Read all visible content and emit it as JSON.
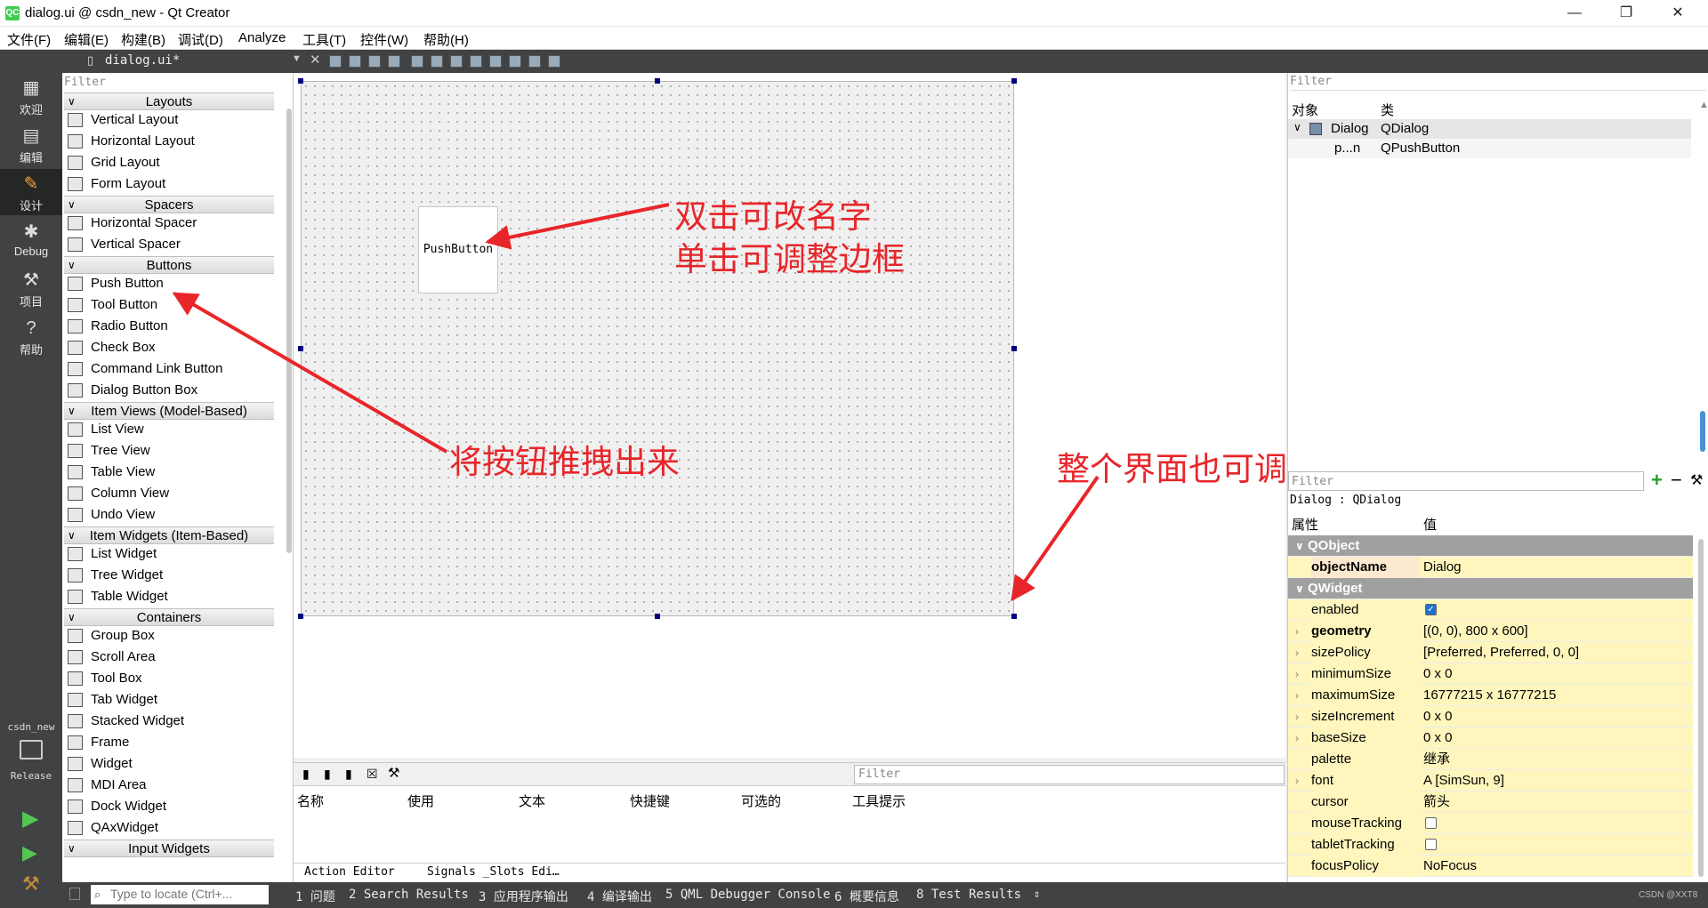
{
  "window": {
    "title": "dialog.ui @ csdn_new - Qt Creator",
    "logo": "QC",
    "minimize": "—",
    "maximize": "❐",
    "close": "✕"
  },
  "menu": [
    "文件(F)",
    "编辑(E)",
    "构建(B)",
    "调试(D)",
    "Analyze",
    "工具(T)",
    "控件(W)",
    "帮助(H)"
  ],
  "modes": [
    {
      "label": "欢迎",
      "icon": "grid-icon"
    },
    {
      "label": "编辑",
      "icon": "edit-icon"
    },
    {
      "label": "设计",
      "icon": "design-icon"
    },
    {
      "label": "Debug",
      "icon": "bug-icon"
    },
    {
      "label": "项目",
      "icon": "wrench-icon"
    },
    {
      "label": "帮助",
      "icon": "help-icon"
    }
  ],
  "kit": {
    "project": "csdn_new",
    "config": "Release"
  },
  "file_tab": {
    "name": "dialog.ui*"
  },
  "widget_box": {
    "filter_placeholder": "Filter",
    "categories": [
      {
        "name": "Layouts",
        "items": [
          "Vertical Layout",
          "Horizontal Layout",
          "Grid Layout",
          "Form Layout"
        ]
      },
      {
        "name": "Spacers",
        "items": [
          "Horizontal Spacer",
          "Vertical Spacer"
        ]
      },
      {
        "name": "Buttons",
        "items": [
          "Push Button",
          "Tool Button",
          "Radio Button",
          "Check Box",
          "Command Link Button",
          "Dialog Button Box"
        ]
      },
      {
        "name": "Item Views (Model-Based)",
        "items": [
          "List View",
          "Tree View",
          "Table View",
          "Column View",
          "Undo View"
        ]
      },
      {
        "name": "Item Widgets (Item-Based)",
        "items": [
          "List Widget",
          "Tree Widget",
          "Table Widget"
        ]
      },
      {
        "name": "Containers",
        "items": [
          "Group Box",
          "Scroll Area",
          "Tool Box",
          "Tab Widget",
          "Stacked Widget",
          "Frame",
          "Widget",
          "MDI Area",
          "Dock Widget",
          "QAxWidget"
        ]
      },
      {
        "name": "Input Widgets",
        "items": []
      }
    ]
  },
  "form": {
    "push_button_text": "PushButton"
  },
  "annotations": {
    "rename": "双击可改名字",
    "border": "单击可调整边框",
    "drag": "将按钮推拽出来",
    "resize": "整个界面也可调整大小"
  },
  "action_editor": {
    "filter_placeholder": "Filter",
    "columns": [
      "名称",
      "使用",
      "文本",
      "快捷键",
      "可选的",
      "工具提示"
    ],
    "tabs": [
      "Action Editor",
      "Signals _Slots Edi…"
    ]
  },
  "object_inspector": {
    "filter_placeholder": "Filter",
    "columns": [
      "对象",
      "类"
    ],
    "rows": [
      {
        "object": "Dialog",
        "class": "QDialog"
      },
      {
        "object": "p...n",
        "class": "QPushButton"
      }
    ]
  },
  "property_editor": {
    "filter_placeholder": "Filter",
    "context": "Dialog : QDialog",
    "columns": [
      "属性",
      "值"
    ],
    "rows": [
      {
        "type": "group",
        "name": "QObject"
      },
      {
        "type": "prop",
        "name": "objectName",
        "value": "Dialog",
        "bold": true,
        "expand": false
      },
      {
        "type": "group",
        "name": "QWidget"
      },
      {
        "type": "prop",
        "name": "enabled",
        "value": "",
        "checkbox": true,
        "checked": true,
        "expand": false
      },
      {
        "type": "prop",
        "name": "geometry",
        "value": "[(0, 0), 800 x 600]",
        "bold": true,
        "expand": true
      },
      {
        "type": "prop",
        "name": "sizePolicy",
        "value": "[Preferred, Preferred, 0, 0]",
        "expand": true
      },
      {
        "type": "prop",
        "name": "minimumSize",
        "value": "0 x 0",
        "expand": true
      },
      {
        "type": "prop",
        "name": "maximumSize",
        "value": "16777215 x 16777215",
        "expand": true
      },
      {
        "type": "prop",
        "name": "sizeIncrement",
        "value": "0 x 0",
        "expand": true
      },
      {
        "type": "prop",
        "name": "baseSize",
        "value": "0 x 0",
        "expand": true
      },
      {
        "type": "prop",
        "name": "palette",
        "value": "继承",
        "expand": false
      },
      {
        "type": "prop",
        "name": "font",
        "value": "A  [SimSun, 9]",
        "expand": true
      },
      {
        "type": "prop",
        "name": "cursor",
        "value": "箭头",
        "expand": false
      },
      {
        "type": "prop",
        "name": "mouseTracking",
        "value": "",
        "checkbox": true,
        "checked": false,
        "expand": false
      },
      {
        "type": "prop",
        "name": "tabletTracking",
        "value": "",
        "checkbox": true,
        "checked": false,
        "expand": false
      },
      {
        "type": "prop",
        "name": "focusPolicy",
        "value": "NoFocus",
        "expand": false
      }
    ]
  },
  "status_bar": {
    "locator_placeholder": "Type to locate (Ctrl+...",
    "panes": [
      "1 问题",
      "2 Search Results",
      "3 应用程序输出",
      "4 编译输出",
      "5 QML Debugger Console",
      "6 概要信息",
      "8 Test Results"
    ],
    "watermark": "CSDN @XXT8"
  },
  "colors": {
    "annotation": "#e8262a",
    "selection_handle": "#000080",
    "dark_chrome": "#404244",
    "property_group": "#a0a0a0",
    "property_highlight": "#fff6bd"
  }
}
